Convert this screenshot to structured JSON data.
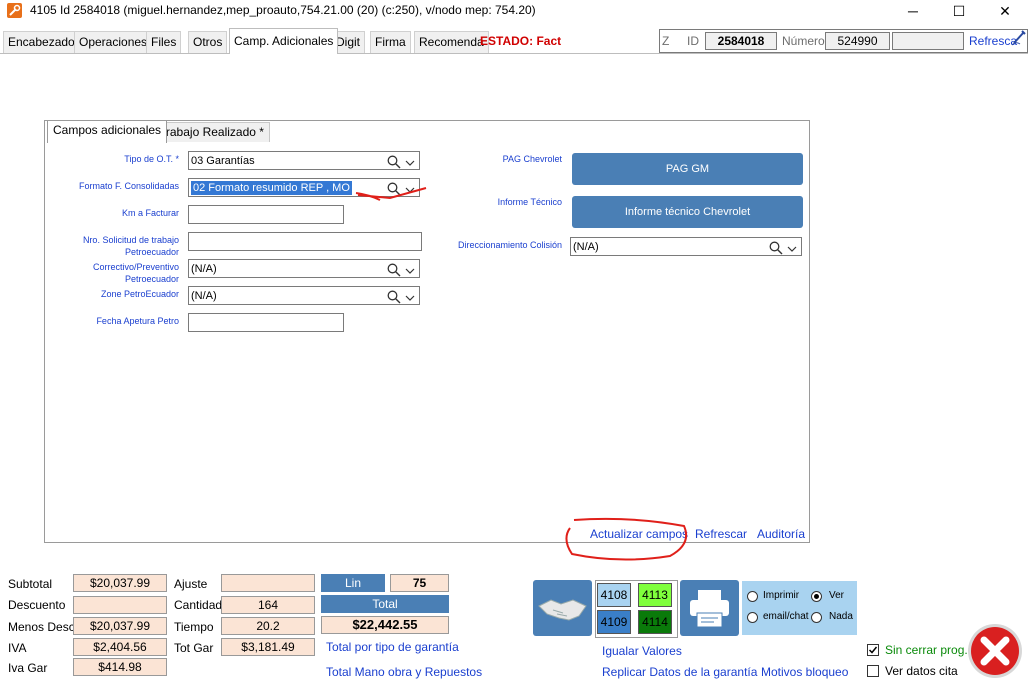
{
  "window": {
    "title": "4105 Id 2584018  (miguel.hernandez,mep_proauto,754.21.00 (20) (c:250), v/nodo mep: 754.20)",
    "minimize": "─",
    "maximize": "☐",
    "close": "✕"
  },
  "tabs": [
    "Encabezado",
    "Operaciones",
    "Files",
    "Otros",
    "Camp. Adicionales",
    "Digit",
    "Firma",
    "Recomenda"
  ],
  "estado": "ESTADO: Fact",
  "header_info": {
    "z_label": "Z",
    "id_label": "ID",
    "id_value": "2584018",
    "numero_label": "Número",
    "numero_value": "524990",
    "refresca": "Refresca"
  },
  "panel_tabs": [
    "Campos adicionales",
    "Trabajo Realizado *"
  ],
  "fields": {
    "tipo_ot": {
      "label": "Tipo de O.T. *",
      "value": "03 Garantías"
    },
    "formato": {
      "label": "Formato F. Consolidadas",
      "value": "02 Formato resumido REP , MO"
    },
    "km": {
      "label": "Km a Facturar",
      "value": ""
    },
    "nro_solicitud": {
      "label1": "Nro. Solicitud de trabajo",
      "label2": "Petroecuador",
      "value": ""
    },
    "correctivo": {
      "label1": "Correctivo/Preventivo",
      "label2": "Petroecuador",
      "value": "(N/A)"
    },
    "zone": {
      "label": "Zone PetroEcuador",
      "value": "(N/A)"
    },
    "fecha": {
      "label": "Fecha Apetura Petro",
      "value": ""
    },
    "pag_chevrolet": {
      "label": "PAG Chevrolet",
      "button": "PAG GM"
    },
    "informe": {
      "label": "Informe Técnico",
      "button": "Informe técnico Chevrolet"
    },
    "direccionamiento": {
      "label": "Direccionamiento Colisión",
      "value": "(N/A)"
    }
  },
  "panel_links": {
    "actualizar": "Actualizar campos",
    "refrescar": "Refrescar",
    "auditoria": "Auditoría"
  },
  "totals": {
    "subtotal": {
      "label": "Subtotal",
      "value": "$20,037.99"
    },
    "descuento": {
      "label": "Descuento",
      "value": ""
    },
    "menos_desc": {
      "label": "Menos Desc",
      "value": "$20,037.99"
    },
    "iva": {
      "label": "IVA",
      "value": "$2,404.56"
    },
    "iva_gar": {
      "label": "Iva Gar",
      "value": "$414.98"
    },
    "ajuste": {
      "label": "Ajuste",
      "value": ""
    },
    "cantidad": {
      "label": "Cantidad",
      "value": "164"
    },
    "tiempo": {
      "label": "Tiempo",
      "value": "20.2"
    },
    "tot_gar": {
      "label": "Tot Gar",
      "value": "$3,181.49"
    },
    "lin_label": "Lin",
    "lin_value": "75",
    "total_label": "Total",
    "total_value": "$22,442.55",
    "total_por_tipo": "Total por tipo de garantía",
    "total_mano": "Total Mano obra y Repuestos"
  },
  "codes": [
    "4108",
    "4113",
    "4109",
    "4114"
  ],
  "print_options": {
    "imprimir": "Imprimir",
    "ver": "Ver",
    "email": "email/chat",
    "nada": "Nada"
  },
  "bottom_links": {
    "igualar": "Igualar Valores",
    "replicar": "Replicar Datos de la garantía",
    "motivos": "Motivos bloqueo"
  },
  "checks": {
    "sin_cerrar": "Sin cerrar prog.",
    "ver_datos": "Ver datos cita"
  },
  "colors": {
    "accent": "#4a7fb5",
    "link": "#1a3fcf",
    "estado": "#d00000",
    "value_bg": "#fbe4d5",
    "annotation": "#e0201a"
  }
}
